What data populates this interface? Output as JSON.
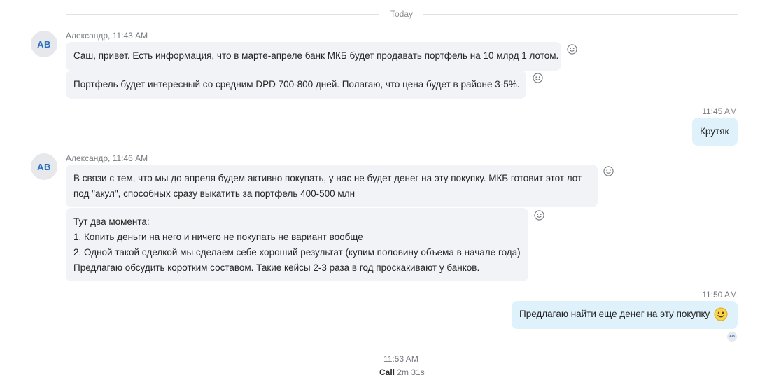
{
  "divider": {
    "label": "Today"
  },
  "groups": [
    {
      "avatar": "AB",
      "sender": "Александр, 11:43 AM",
      "messages": [
        {
          "lines": [
            "Саш, привет. Есть информация, что в марте-апреле банк МКБ будет продавать портфель на 10 млрд 1 лотом."
          ]
        },
        {
          "lines": [
            "Портфель будет интересный со средним DPD 700-800 дней. Полагаю, что цена будет в районе 3-5%."
          ]
        }
      ]
    },
    {
      "avatar": "AB",
      "sender": "Александр, 11:46 AM",
      "messages": [
        {
          "lines": [
            "В связи с тем, что мы до апреля будем активно покупать, у нас не будет денег на эту покупку. МКБ готовит этот лот",
            "под \"акул\", способных сразу выкатить за портфель 400-500 млн"
          ]
        },
        {
          "lines": [
            "Тут два момента:",
            "1. Копить деньги на него и ничего не покупать не вариант вообще",
            "2. Одной такой сделкой мы сделаем себе хороший результат (купим половину объема в начале года)",
            "Предлагаю обсудить коротким составом. Такие кейсы 2-3 раза в год проскакивают у банков."
          ]
        }
      ]
    }
  ],
  "outgoing": [
    {
      "time": "11:45 AM",
      "text": "Крутяк"
    },
    {
      "time": "11:50 AM",
      "text": "Предлагаю найти еще денег на эту покупку",
      "emoji": "smiley-emoji"
    }
  ],
  "read_receipt": {
    "initials": "AB"
  },
  "call": {
    "time": "11:53 AM",
    "label": "Call",
    "duration": "2m 31s"
  },
  "colors": {
    "incoming_bubble": "#f1f3f6",
    "outgoing_bubble": "#dff2fb",
    "avatar_text": "#2a6fbf"
  },
  "icons": {
    "reaction": "smiley-reaction-icon"
  }
}
